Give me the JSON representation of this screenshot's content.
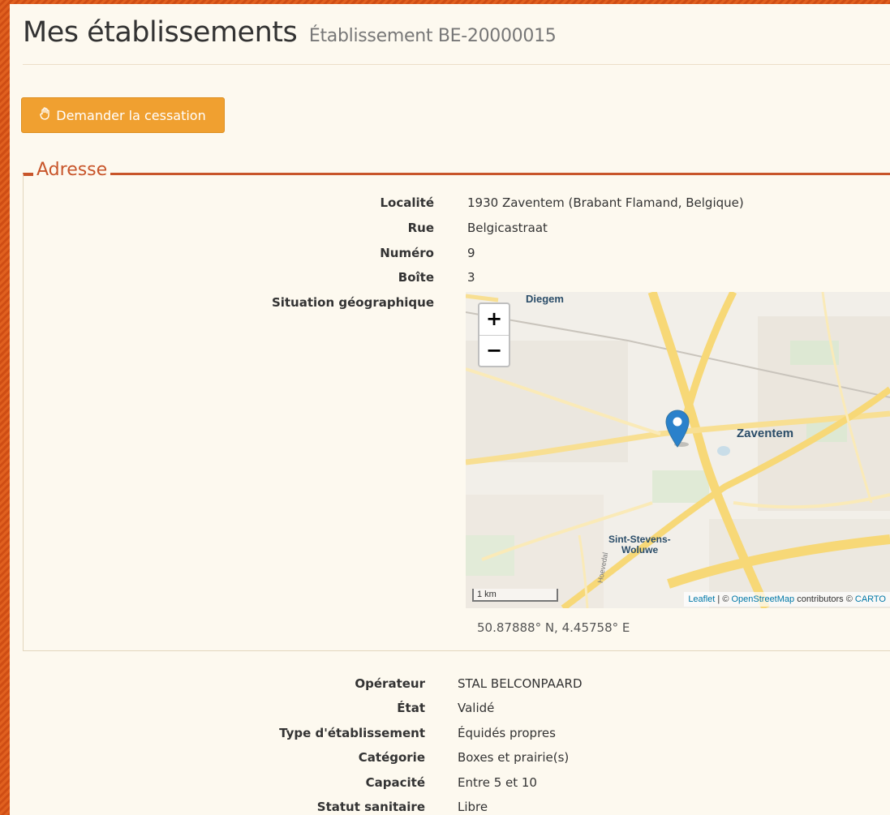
{
  "header": {
    "title": "Mes établissements",
    "subtitle": "Établissement BE-20000015"
  },
  "actions": {
    "cease_label": "Demander la cessation",
    "cease_icon": "hand-icon"
  },
  "address": {
    "legend": "Adresse",
    "fields": [
      {
        "label": "Localité",
        "value": "1930 Zaventem (Brabant Flamand, Belgique)"
      },
      {
        "label": "Rue",
        "value": "Belgicastraat"
      },
      {
        "label": "Numéro",
        "value": "9"
      },
      {
        "label": "Boîte",
        "value": "3"
      },
      {
        "label": "Situation géographique",
        "value": ""
      }
    ],
    "map": {
      "zoom_in": "+",
      "zoom_out": "−",
      "scale": "1 km",
      "attribution_leaflet": "Leaflet",
      "attribution_sep": " | © ",
      "attribution_osm": "OpenStreetMap",
      "attribution_contrib": " contributors © ",
      "attribution_carto": "CARTO",
      "labels": {
        "diegem": "Diegem",
        "zaventem": "Zaventem",
        "sint_stevens_1": "Sint-Stevens-",
        "sint_stevens_2": "Woluwe",
        "street": "Hoevedal"
      },
      "marker_color": "#2a81cb"
    },
    "coordinates": "50.87888° N, 4.45758° E"
  },
  "details": [
    {
      "label": "Opérateur",
      "value": "STAL BELCONPAARD"
    },
    {
      "label": "État",
      "value": "Validé"
    },
    {
      "label": "Type d'établissement",
      "value": "Équidés propres"
    },
    {
      "label": "Catégorie",
      "value": "Boxes et prairie(s)"
    },
    {
      "label": "Capacité",
      "value": "Entre 5 et 10"
    },
    {
      "label": "Statut sanitaire",
      "value": "Libre"
    }
  ],
  "colors": {
    "accent": "#c8552a",
    "button": "#f0a030",
    "page_bg": "#fdf9ef"
  }
}
